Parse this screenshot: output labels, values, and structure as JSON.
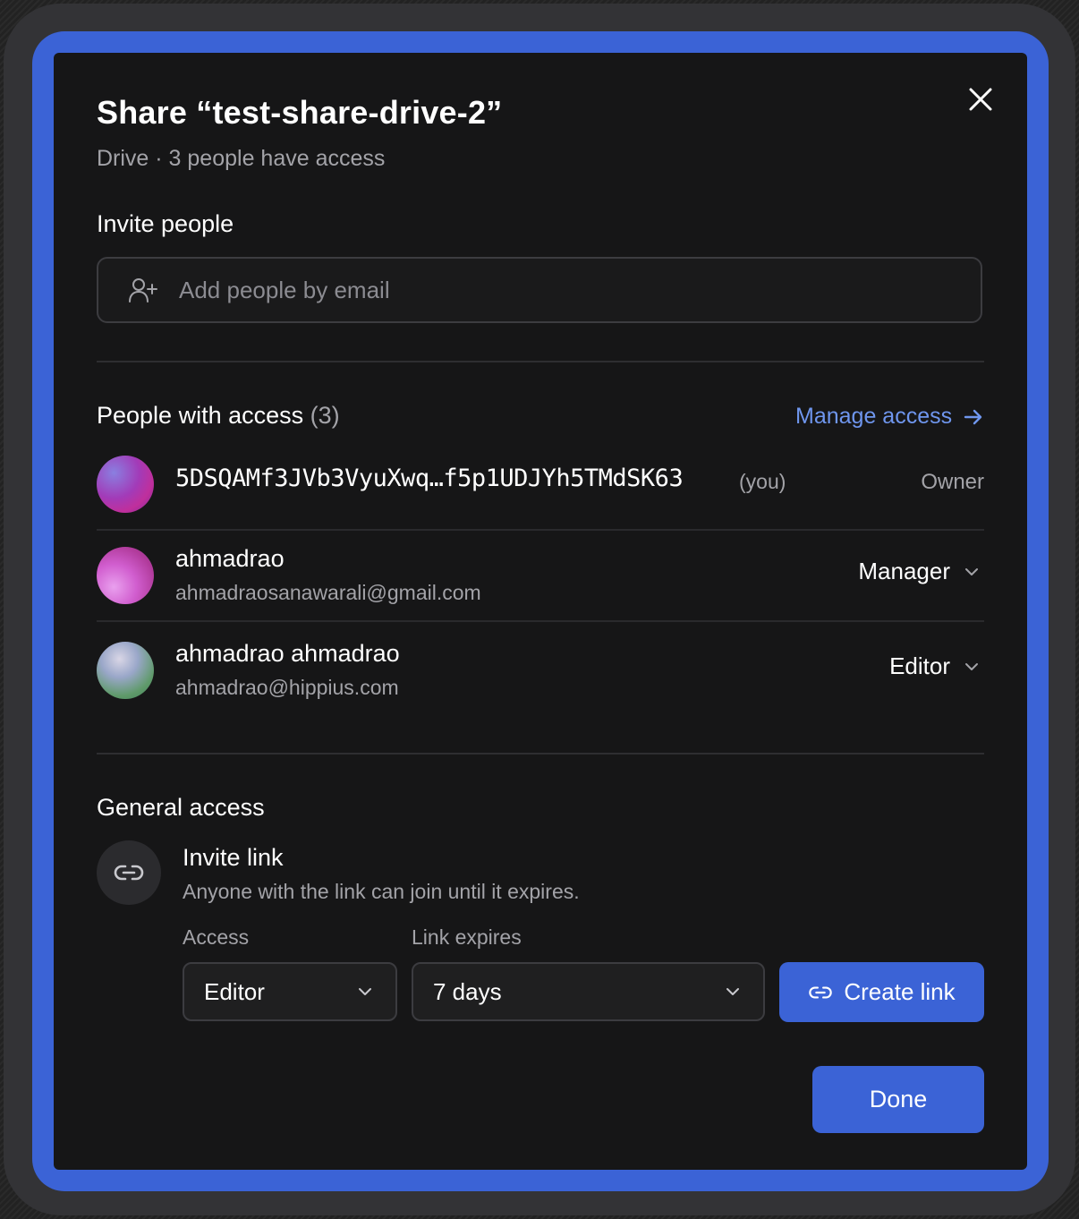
{
  "dialog": {
    "title": "Share “test-share-drive-2”",
    "subtitle": "Drive · 3 people have access",
    "close_icon": "close-icon"
  },
  "invite": {
    "label": "Invite people",
    "placeholder": "Add people by email",
    "icon": "add-user-icon"
  },
  "people": {
    "label": "People with access",
    "count": "(3)",
    "manage_link": "Manage access",
    "list": [
      {
        "id": "5DSQAMf3JVb3VyuXwq…f5p1UDJYh5TMdSK63",
        "you": "(you)",
        "role": "Owner"
      },
      {
        "name": "ahmadrao",
        "email": "ahmadraosanawarali@gmail.com",
        "role": "Manager"
      },
      {
        "name": "ahmadrao ahmadrao",
        "email": "ahmadrao@hippius.com",
        "role": "Editor"
      }
    ]
  },
  "general": {
    "label": "General access",
    "invite_title": "Invite link",
    "invite_desc": "Anyone with the link can join until it expires.",
    "access_label": "Access",
    "access_value": "Editor",
    "expires_label": "Link expires",
    "expires_value": "7 days",
    "create_label": "Create link"
  },
  "footer": {
    "done_label": "Done"
  },
  "colors": {
    "accent": "#3b63d6",
    "link": "#6f96ee",
    "background": "#161617"
  }
}
